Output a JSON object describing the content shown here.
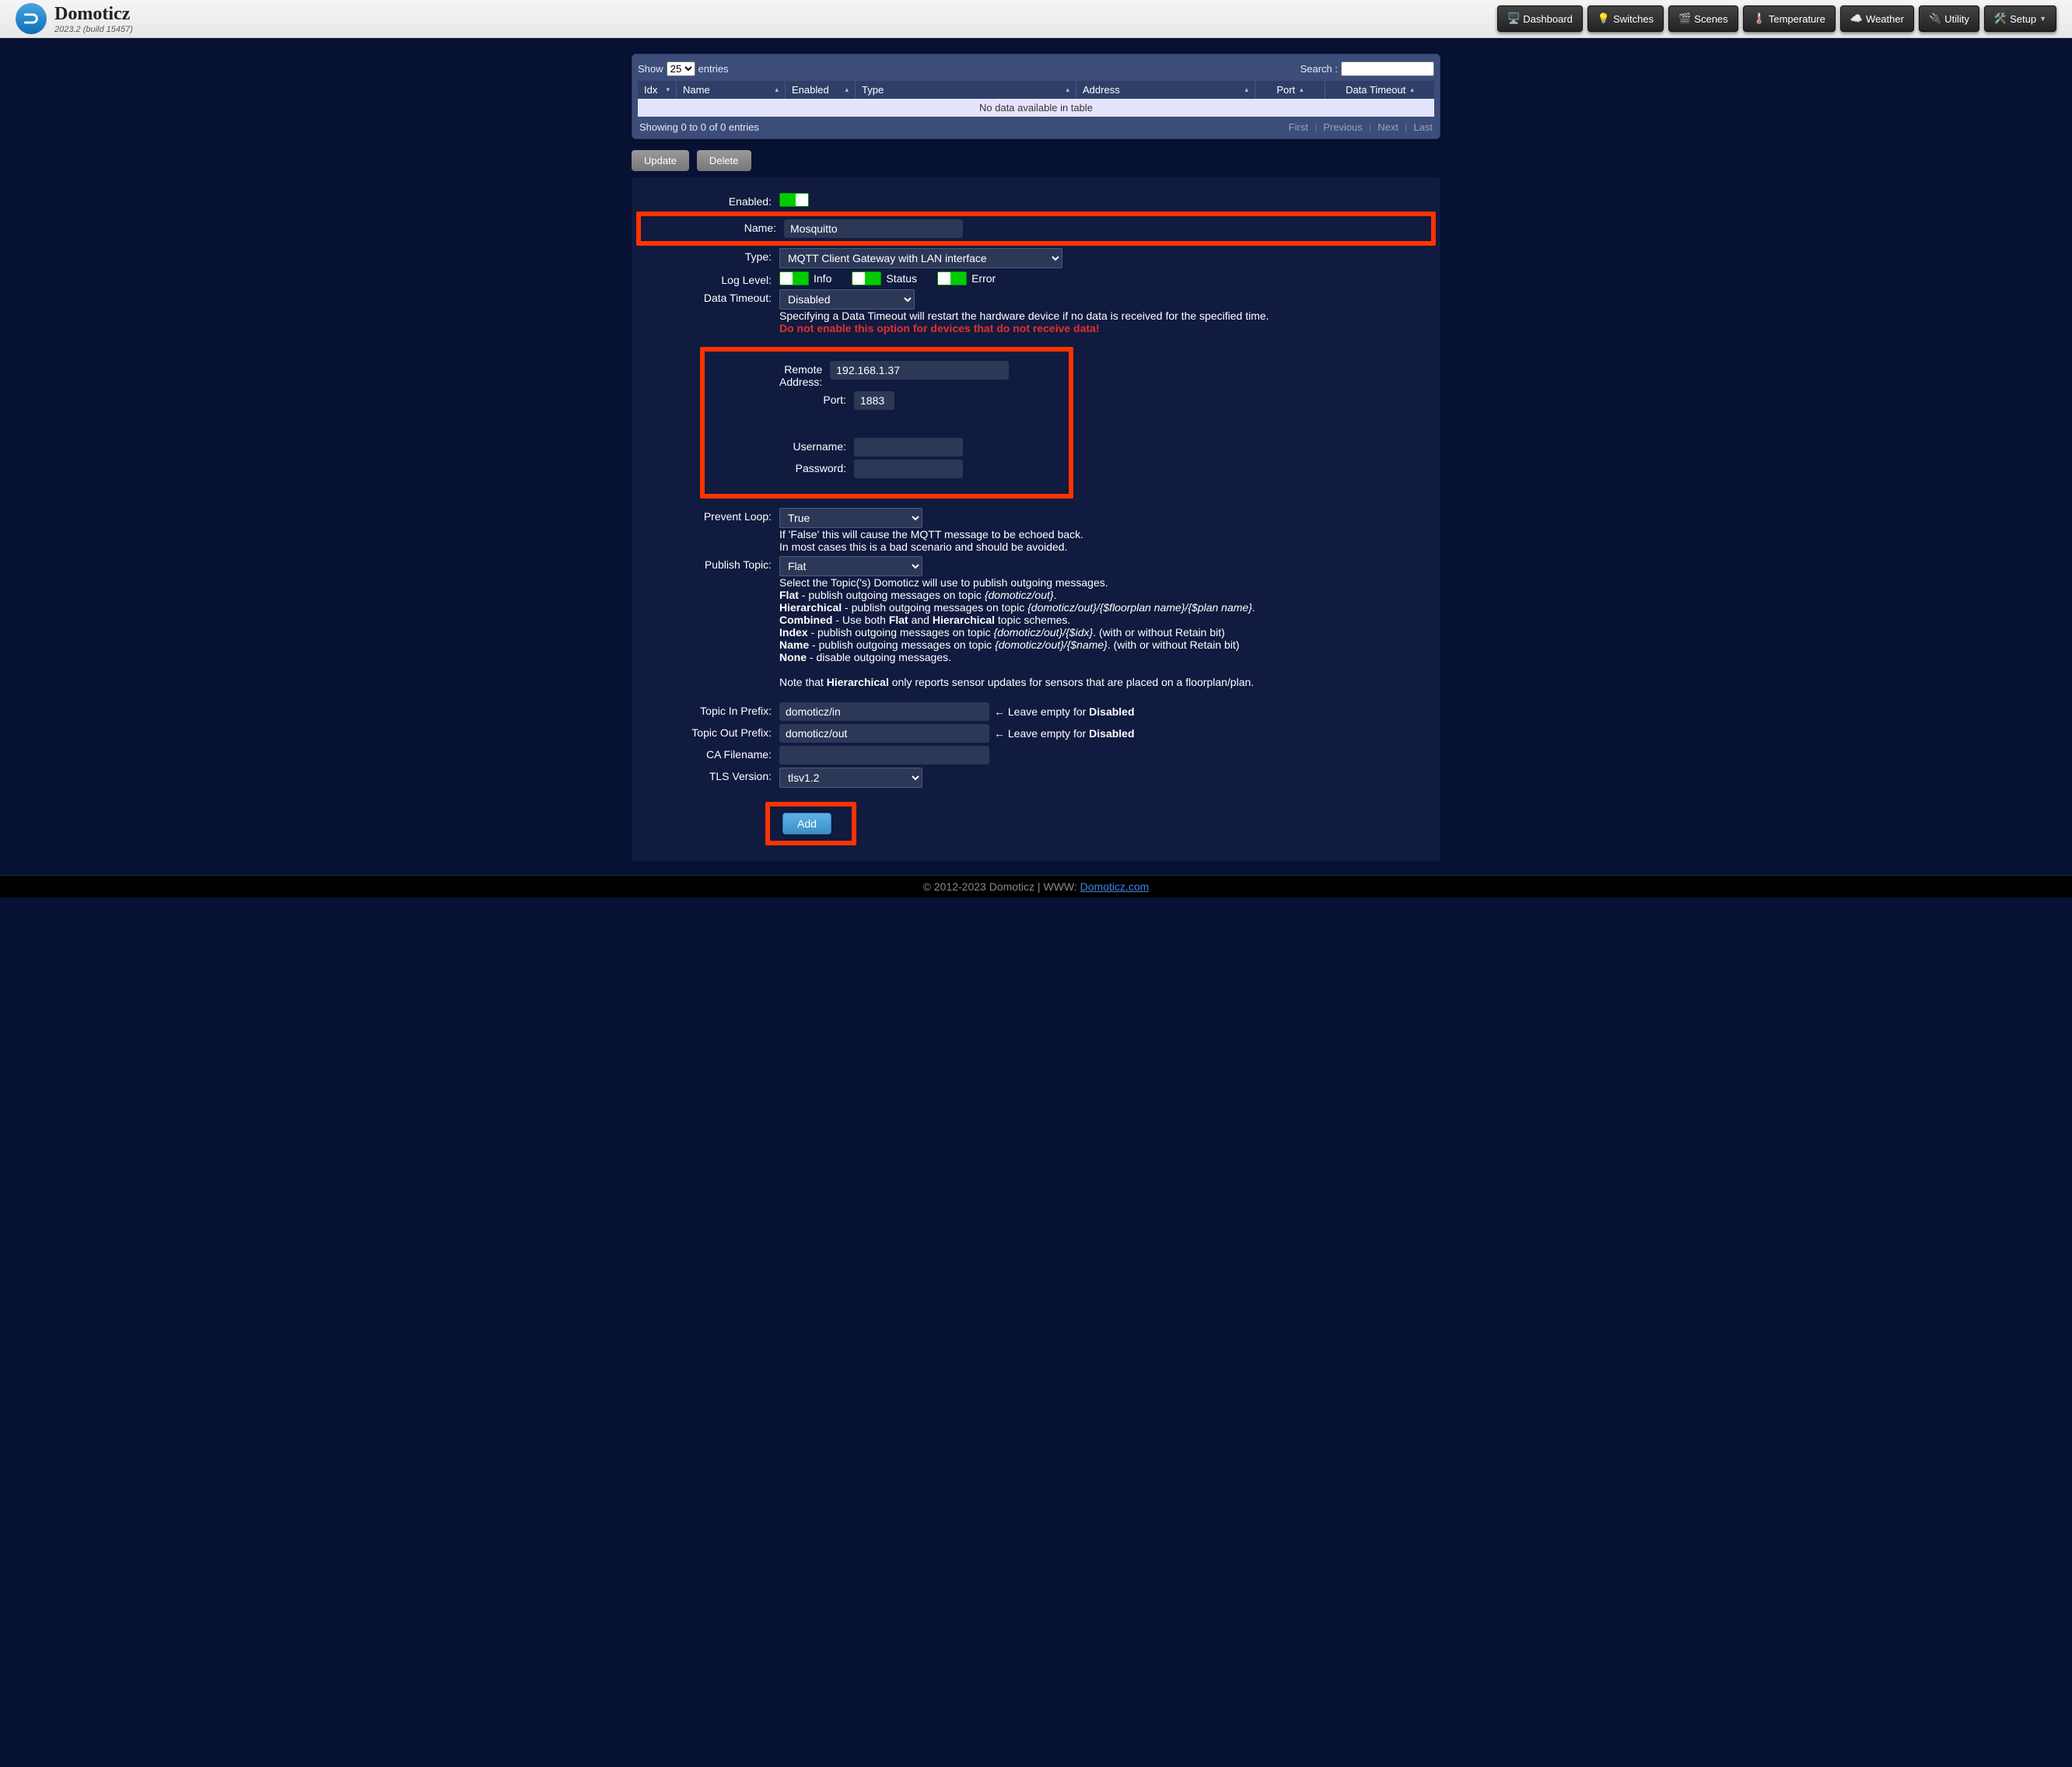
{
  "app": {
    "name": "Domoticz",
    "version": "2023.2 (build 15457)"
  },
  "nav": {
    "dashboard": "Dashboard",
    "switches": "Switches",
    "scenes": "Scenes",
    "temperature": "Temperature",
    "weather": "Weather",
    "utility": "Utility",
    "setup": "Setup"
  },
  "dt": {
    "show": "Show",
    "entries": "entries",
    "entries_sel": "25",
    "search": "Search :",
    "cols": {
      "idx": "Idx",
      "name": "Name",
      "enabled": "Enabled",
      "type": "Type",
      "address": "Address",
      "port": "Port",
      "timeout": "Data Timeout"
    },
    "empty": "No data available in table",
    "info": "Showing 0 to 0 of 0 entries",
    "first": "First",
    "prev": "Previous",
    "next": "Next",
    "last": "Last"
  },
  "actions": {
    "update": "Update",
    "delete": "Delete"
  },
  "form": {
    "enabled_label": "Enabled:",
    "name_label": "Name:",
    "name_value": "Mosquitto",
    "type_label": "Type:",
    "type_value": "MQTT Client Gateway with LAN interface",
    "loglevel_label": "Log Level:",
    "log_info": "Info",
    "log_status": "Status",
    "log_error": "Error",
    "timeout_label": "Data Timeout:",
    "timeout_value": "Disabled",
    "timeout_help1": "Specifying a Data Timeout will restart the hardware device if no data is received for the specified time.",
    "timeout_help2": "Do not enable this option for devices that do not receive data!",
    "remote_label": "Remote Address:",
    "remote_value": "192.168.1.37",
    "port_label": "Port:",
    "port_value": "1883",
    "user_label": "Username:",
    "pass_label": "Password:",
    "prevent_label": "Prevent Loop:",
    "prevent_value": "True",
    "prevent_help1": "If 'False' this will cause the MQTT message to be echoed back.",
    "prevent_help2": "In most cases this is a bad scenario and should be avoided.",
    "pubtopic_label": "Publish Topic:",
    "pubtopic_value": "Flat",
    "pubtopic_desc_intro": "Select the Topic('s) Domoticz will use to publish outgoing messages.",
    "pub_flat_b": "Flat",
    "pub_flat_t": " - publish outgoing messages on topic ",
    "pub_flat_i": "{domoticz/out}",
    "pub_flat_end": ".",
    "pub_hier_b": "Hierarchical",
    "pub_hier_t": " - publish outgoing messages on topic ",
    "pub_hier_i": "{domoticz/out}/{$floorplan name}/{$plan name}",
    "pub_hier_end": ".",
    "pub_comb_b": "Combined",
    "pub_comb_t": " - Use both ",
    "pub_comb_b2": "Flat",
    "pub_comb_t2": " and ",
    "pub_comb_b3": "Hierarchical",
    "pub_comb_t3": " topic schemes.",
    "pub_idx_b": "Index",
    "pub_idx_t": " - publish outgoing messages on topic ",
    "pub_idx_i": "{domoticz/out}/{$idx}",
    "pub_idx_end": ". (with or without Retain bit)",
    "pub_name_b": "Name",
    "pub_name_t": " - publish outgoing messages on topic ",
    "pub_name_i": "{domoticz/out}/{$name}",
    "pub_name_end": ". (with or without Retain bit)",
    "pub_none_b": "None",
    "pub_none_t": " - disable outgoing messages.",
    "pub_note1": "Note that ",
    "pub_note_b": "Hierarchical",
    "pub_note2": " only reports sensor updates for sensors that are placed on a floorplan/plan.",
    "tin_label": "Topic In Prefix:",
    "tin_value": "domoticz/in",
    "tout_label": "Topic Out Prefix:",
    "tout_value": "domoticz/out",
    "prefix_hint_arrow": "←",
    "prefix_hint_text": " Leave empty for ",
    "prefix_hint_b": "Disabled",
    "cafile_label": "CA Filename:",
    "tls_label": "TLS Version:",
    "tls_value": "tlsv1.2",
    "add": "Add"
  },
  "footer": {
    "copy": "© 2012-2023 Domoticz | WWW: ",
    "link": "Domoticz.com"
  }
}
